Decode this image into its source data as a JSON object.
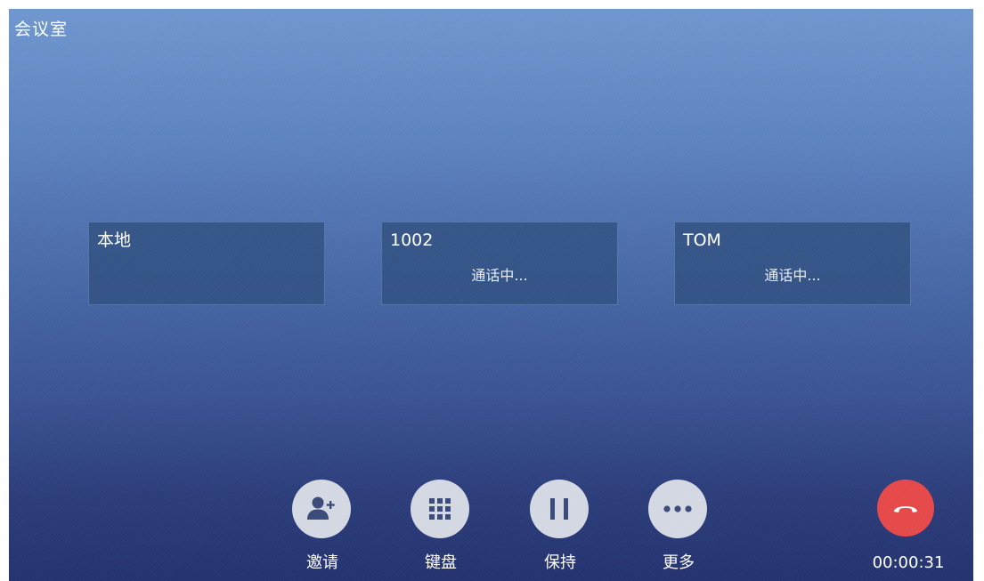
{
  "header": {
    "title": "会议室"
  },
  "participants": [
    {
      "name": "本地",
      "status": ""
    },
    {
      "name": "1002",
      "status": "通话中..."
    },
    {
      "name": "TOM",
      "status": "通话中..."
    }
  ],
  "actions": {
    "invite": {
      "label": "邀请",
      "icon": "add-person-icon"
    },
    "keypad": {
      "label": "键盘",
      "icon": "keypad-icon"
    },
    "hold": {
      "label": "保持",
      "icon": "pause-icon"
    },
    "more": {
      "label": "更多",
      "icon": "more-icon"
    }
  },
  "call": {
    "hangup_icon": "phone-hangup-icon",
    "duration": "00:00:31"
  },
  "colors": {
    "hangup": "#e5494a",
    "action_button": "#d3d8e2",
    "icon": "#3a4a7a"
  }
}
